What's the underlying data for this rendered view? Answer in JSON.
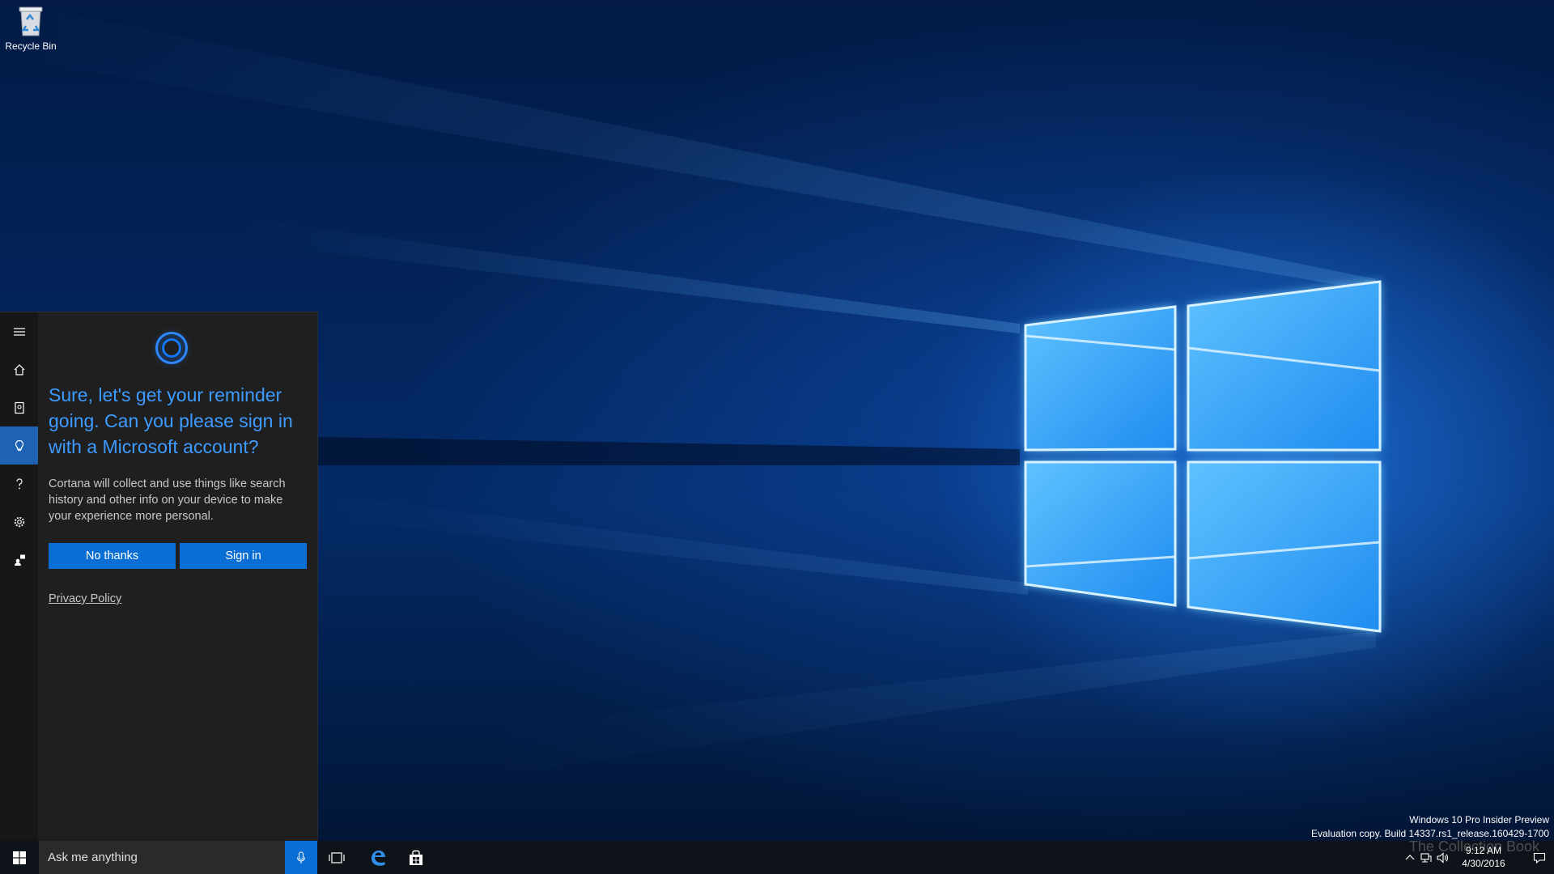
{
  "desktop": {
    "icons": [
      {
        "label": "Recycle Bin",
        "icon": "recycle-bin-icon"
      }
    ]
  },
  "cortana": {
    "rail": [
      {
        "name": "hamburger-menu-icon"
      },
      {
        "name": "home-icon"
      },
      {
        "name": "notebook-icon"
      },
      {
        "name": "reminders-lightbulb-icon",
        "active": true
      },
      {
        "name": "help-icon"
      },
      {
        "name": "settings-gear-icon"
      },
      {
        "name": "feedback-icon"
      }
    ],
    "headline": "Sure, let's get your reminder going. Can you please sign in with a Microsoft account?",
    "body": "Cortana will collect and use things like search history and other info on your device to make your experience more personal.",
    "no_thanks_label": "No thanks",
    "sign_in_label": "Sign in",
    "privacy_label": "Privacy Policy"
  },
  "watermark": {
    "line1": "Windows 10 Pro Insider Preview",
    "line2": "Evaluation copy. Build 14337.rs1_release.160429-1700"
  },
  "taskbar": {
    "search_placeholder": "Ask me anything",
    "pinned": [
      "task-view-icon",
      "edge-icon",
      "store-icon"
    ],
    "clock_time": "9:12 AM",
    "clock_date": "4/30/2016"
  },
  "overlay": {
    "text": "The Collection Book"
  },
  "colors": {
    "accent": "#0a6fd4",
    "headline": "#3d9bff",
    "panel": "#1f1f1f",
    "taskbar": "#0e1219"
  }
}
